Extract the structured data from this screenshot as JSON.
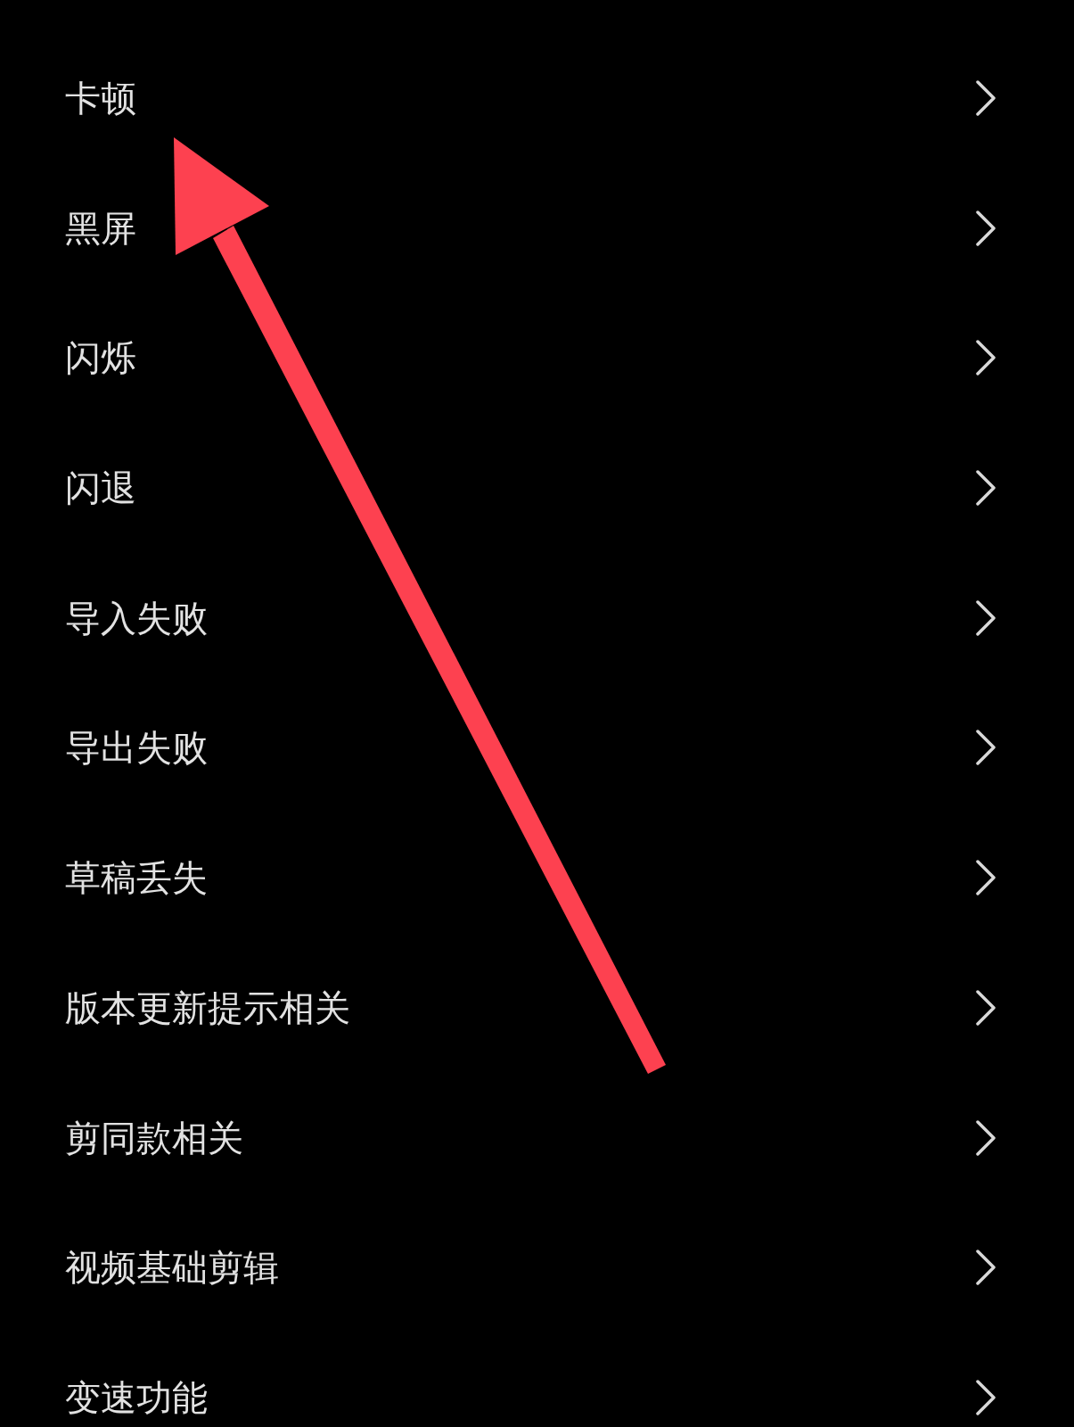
{
  "menu": {
    "items": [
      {
        "label": "卡顿"
      },
      {
        "label": "黑屏"
      },
      {
        "label": "闪烁"
      },
      {
        "label": "闪退"
      },
      {
        "label": "导入失败"
      },
      {
        "label": "导出失败"
      },
      {
        "label": "草稿丢失"
      },
      {
        "label": "版本更新提示相关"
      },
      {
        "label": "剪同款相关"
      },
      {
        "label": "视频基础剪辑"
      },
      {
        "label": "变速功能"
      }
    ]
  },
  "overlay": {
    "kind": "arrow"
  }
}
